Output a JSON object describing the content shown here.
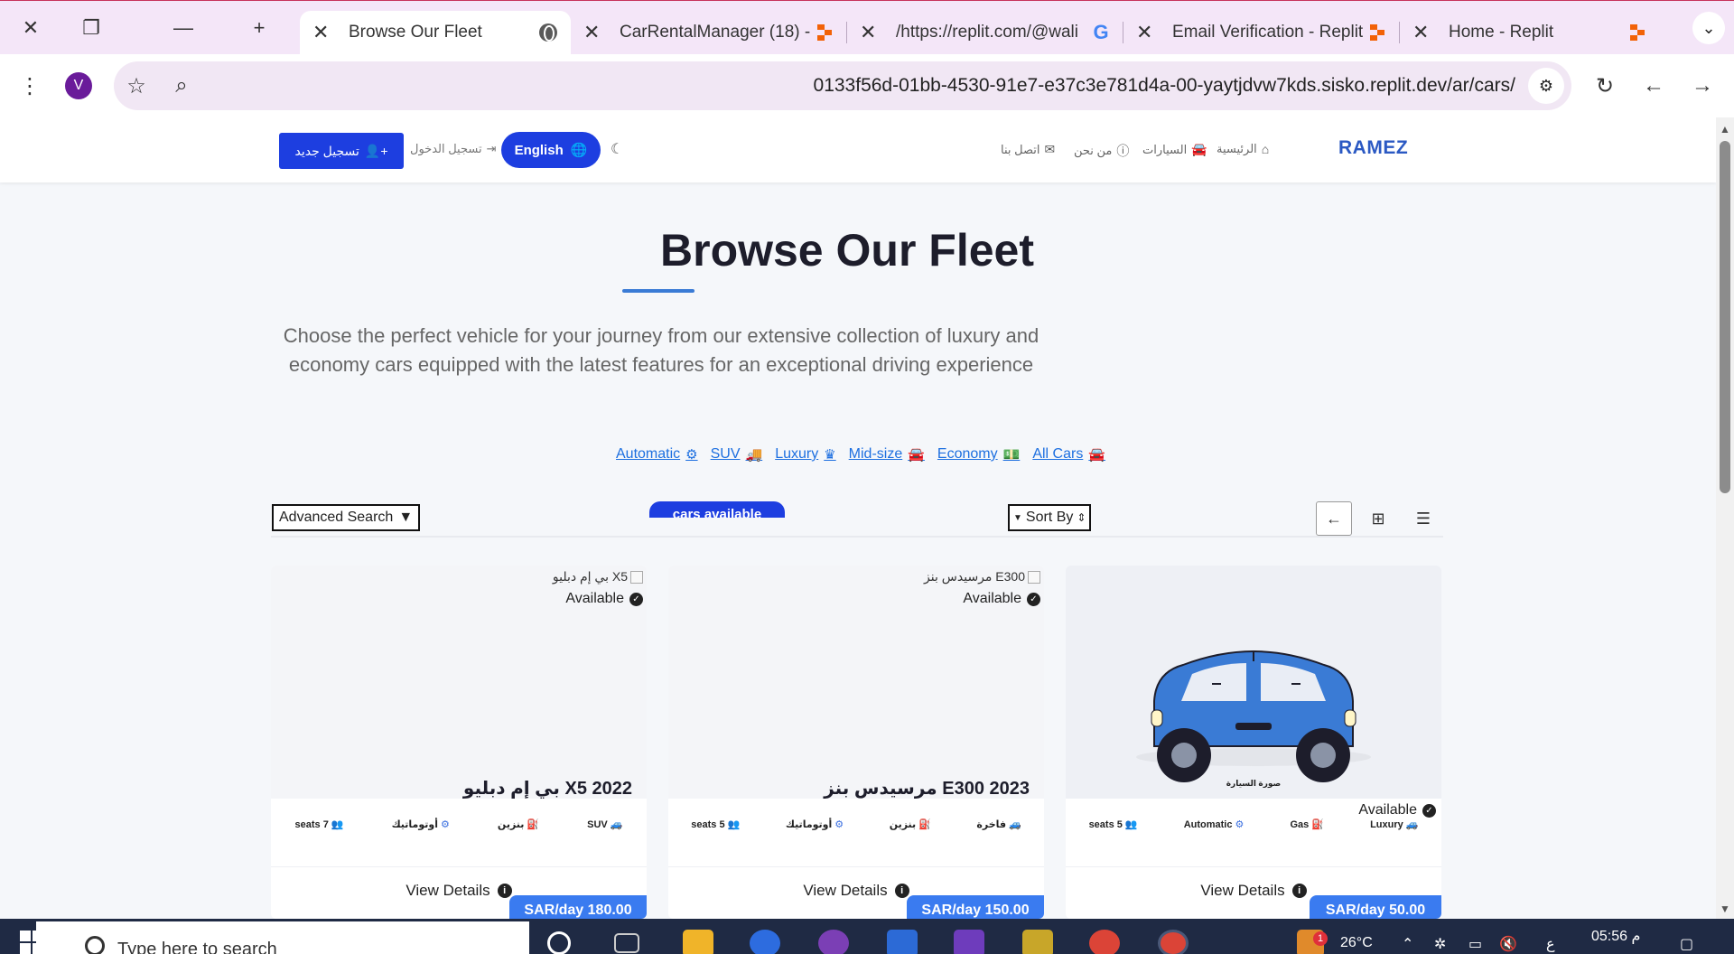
{
  "browser": {
    "tabs": [
      {
        "title": "Browse Our Fleet",
        "favicon": "globe-icon",
        "active": true
      },
      {
        "title": "CarRentalManager (18) -",
        "favicon": "replit-icon",
        "active": false
      },
      {
        "title": "/https://replit.com/@wali",
        "favicon": "google-icon",
        "active": false
      },
      {
        "title": "Email Verification - Replit",
        "favicon": "replit-icon",
        "active": false
      },
      {
        "title": "Home - Replit",
        "favicon": "replit-icon",
        "active": false
      }
    ],
    "profile_initial": "V",
    "url": "0133f56d-01bb-4530-91e7-e37c3e781d4a-00-yaytjdvw7kds.sisko.replit.dev/ar/cars/"
  },
  "site": {
    "brand": "RAMEZ",
    "nav": {
      "home": "الرئيسية",
      "cars": "السيارات",
      "about": "من نحن",
      "contact": "اتصل بنا"
    },
    "register": "تسجيل جديد",
    "login": "تسجيل الدخول",
    "language": "English"
  },
  "hero": {
    "title": "Browse Our Fleet",
    "description": "Choose the perfect vehicle for your journey from our extensive collection of luxury and economy cars equipped with the latest features for an exceptional driving experience"
  },
  "filters": [
    "Automatic",
    "SUV",
    "Luxury",
    "Mid-size",
    "Economy",
    "All Cars"
  ],
  "controls": {
    "advanced_search": "Advanced Search",
    "count_label": "cars available",
    "sort_by": "Sort By"
  },
  "cars": [
    {
      "image_alt": "بي إم دبليو X5",
      "status": "Available",
      "name": "بي إم دبليو X5 2022",
      "specs": {
        "category": "SUV",
        "fuel": "بنزين",
        "transmission": "أوتوماتيك",
        "seats": "seats 7"
      },
      "details": "View Details",
      "price": "SAR/day 180.00"
    },
    {
      "image_alt": "مرسيدس بنز E300",
      "status": "Available",
      "name": "مرسيدس بنز E300 2023",
      "specs": {
        "category": "فاخرة",
        "fuel": "بنزين",
        "transmission": "أوتوماتيك",
        "seats": "seats 5"
      },
      "details": "View Details",
      "price": "SAR/day 150.00"
    },
    {
      "image_caption": "صورة السيارة",
      "status": "Available",
      "specs": {
        "category": "Luxury",
        "fuel": "Gas",
        "transmission": "Automatic",
        "seats": "seats 5"
      },
      "details": "View Details",
      "price": "SAR/day 50.00"
    }
  ],
  "taskbar": {
    "search_placeholder": "Type here to search",
    "weather": "26°C",
    "lang_indicator": "ع",
    "time": "05:56 م",
    "notification_count": "1"
  },
  "colors": {
    "primary": "#1d3ee0",
    "accent": "#3a7bf0",
    "brand": "#2b59c3",
    "tabstrip": "#f4e6f8",
    "car_body": "#3a7bd5"
  }
}
